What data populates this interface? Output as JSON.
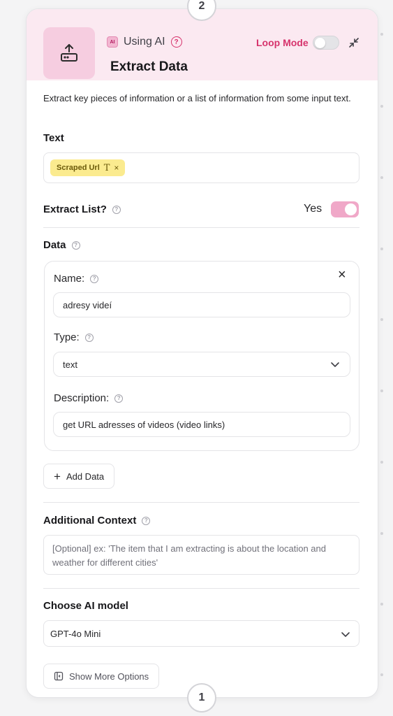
{
  "steps": {
    "top": "2",
    "bottom": "1"
  },
  "header": {
    "ai_label": "Using AI",
    "ai_badge": "AI",
    "title": "Extract Data",
    "loop_mode": "Loop Mode",
    "loop_enabled": false
  },
  "description": "Extract key pieces of information or a list of information from some input text.",
  "text_section": {
    "label": "Text",
    "chip_label": "Scraped Url",
    "chip_type_icon": "T",
    "chip_remove": "×"
  },
  "extract_list": {
    "label": "Extract List?",
    "value_label": "Yes",
    "enabled": true
  },
  "data_section": {
    "label": "Data",
    "remove": "×",
    "name_label": "Name:",
    "name_value": "adresy videí",
    "type_label": "Type:",
    "type_value": "text",
    "description_label": "Description:",
    "description_value": "get URL adresses of videos (video links)",
    "add_button": "Add Data",
    "add_icon": "+"
  },
  "additional_context": {
    "label": "Additional Context",
    "placeholder": "[Optional] ex: 'The item that I am extracting is about the location and weather for different cities'"
  },
  "model": {
    "label": "Choose AI model",
    "value": "GPT-4o Mini"
  },
  "more_options": "Show More Options",
  "colors": {
    "accent_pink": "#d6336c",
    "header_bg": "#fbe9f1",
    "chip_bg": "#fbeb8f",
    "toggle_on": "#f0a8c8"
  }
}
